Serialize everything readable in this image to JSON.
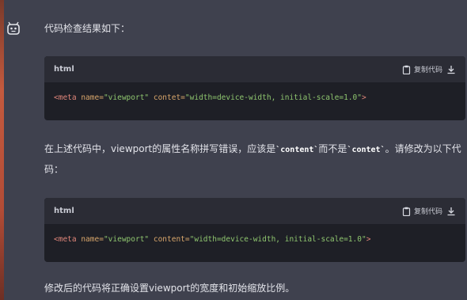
{
  "intro": "代码检查结果如下：",
  "blocks": [
    {
      "lang": "html",
      "copy_label": "复制代码",
      "code": {
        "open": "<meta",
        "attr1": " name=",
        "val1": "\"viewport\"",
        "attr2": " contet=",
        "val2": "\"width=device-width, initial-scale=1.0\"",
        "close": ">"
      }
    },
    {
      "lang": "html",
      "copy_label": "复制代码",
      "code": {
        "open": "<meta",
        "attr1": " name=",
        "val1": "\"viewport\"",
        "attr2": " content=",
        "val2": "\"width=device-width, initial-scale=1.0\"",
        "close": ">"
      }
    }
  ],
  "explanation": {
    "part1": "在上述代码中，viewport的属性名称拼写错误，应该是",
    "kw1": "`content`",
    "part2": "而不是",
    "kw2": "`contet`",
    "part3": "。请修改为以下代码："
  },
  "conclusion": "修改后的代码将正确设置viewport的宽度和初始缩放比例。"
}
